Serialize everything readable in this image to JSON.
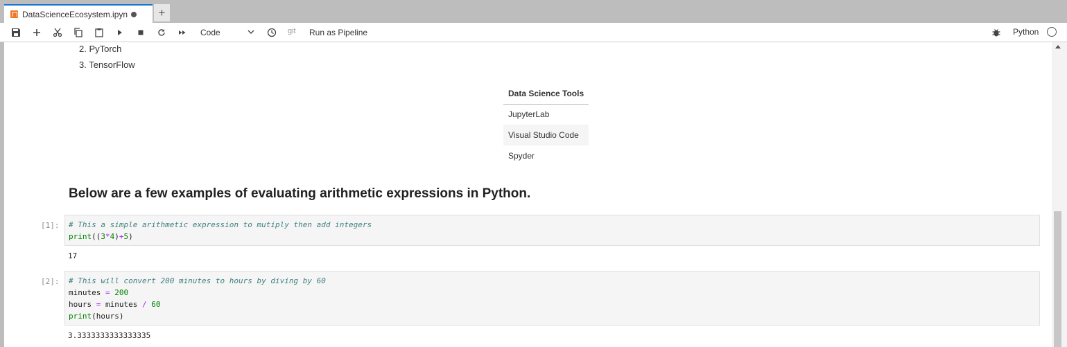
{
  "tab": {
    "title": "DataScienceEcosystem.ipyn",
    "add_label": "+"
  },
  "toolbar": {
    "cell_type": "Code",
    "git_label": "git",
    "pipeline_label": "Run as Pipeline",
    "kernel_name": "Python",
    "icons": [
      "save-icon",
      "add-cell-icon",
      "cut-icon",
      "copy-icon",
      "paste-icon",
      "run-icon",
      "stop-icon",
      "restart-icon",
      "fast-forward-icon",
      "clock-icon",
      "bug-icon",
      "kernel-status-icon"
    ]
  },
  "markdown_list": [
    "2. PyTorch",
    "3. TensorFlow"
  ],
  "tools_table": {
    "header": "Data Science Tools",
    "rows": [
      "JupyterLab",
      "Visual Studio Code",
      "Spyder"
    ]
  },
  "heading": "Below are a few examples of evaluating arithmetic expressions in Python.",
  "cells": [
    {
      "prompt": "[1]:",
      "lines": {
        "l1": "# This a simple arithmetic expression to mutiply then add integers",
        "l2_fn": "print",
        "l2_open": "((",
        "l2_a": "3",
        "l2_op1": "*",
        "l2_b": "4",
        "l2_mid": ")",
        "l2_op2": "+",
        "l2_c": "5",
        "l2_close": ")"
      },
      "output": "17"
    },
    {
      "prompt": "[2]:",
      "lines": {
        "l1": "# This will convert 200 minutes to hours by diving by 60",
        "l2_var": "minutes",
        "l2_op": "=",
        "l2_val": "200",
        "l3_var": "hours",
        "l3_op": "=",
        "l3_mid": "minutes",
        "l3_div": "/",
        "l3_val": "60",
        "l4_fn": "print",
        "l4_arg": "(hours)"
      },
      "output": "3.3333333333333335"
    }
  ]
}
